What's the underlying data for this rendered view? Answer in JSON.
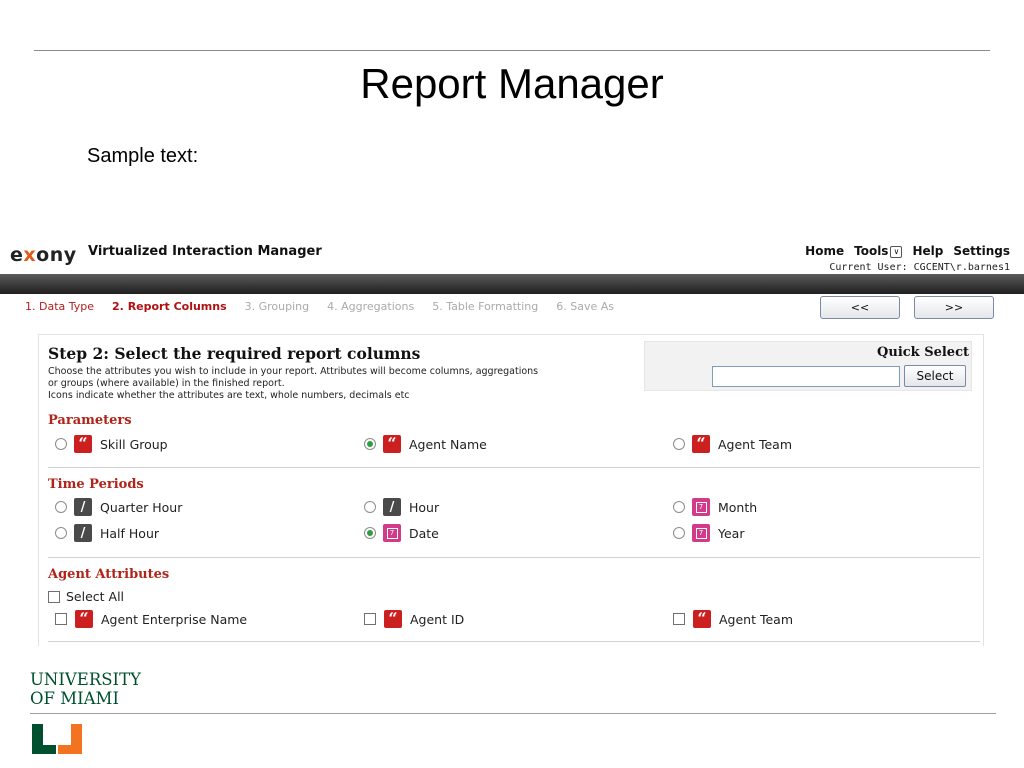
{
  "slide": {
    "title": "Report Manager",
    "sample_text": "Sample text:"
  },
  "app": {
    "logo": {
      "part1": "e",
      "part2": "x",
      "part3": "ony"
    },
    "title": "Virtualized Interaction Manager",
    "nav": {
      "home": "Home",
      "tools": "Tools",
      "help": "Help",
      "settings": "Settings"
    },
    "current_user": "Current User: CGCENT\\r.barnes1"
  },
  "wizard": {
    "steps": [
      {
        "label": "1. Data Type"
      },
      {
        "label": "2. Report Columns"
      },
      {
        "label": "3. Grouping"
      },
      {
        "label": "4. Aggregations"
      },
      {
        "label": "5. Table Formatting"
      },
      {
        "label": "6. Save As"
      }
    ],
    "prev_label": "<<",
    "next_label": ">>"
  },
  "step": {
    "heading": "Step 2: Select the required report columns",
    "desc_line1": "Choose the attributes you wish to include in your report. Attributes will become columns, aggregations",
    "desc_line2": "or groups (where available) in the finished report.",
    "desc_line3": "Icons indicate whether the attributes are text, whole numbers, decimals etc"
  },
  "quick_select": {
    "label": "Quick Select",
    "value": "",
    "button": "Select"
  },
  "parameters": {
    "title": "Parameters",
    "items": [
      {
        "label": "Skill Group",
        "selected": false,
        "icon": "text-icon"
      },
      {
        "label": "Agent Name",
        "selected": true,
        "icon": "text-icon"
      },
      {
        "label": "Agent Team",
        "selected": false,
        "icon": "text-icon"
      }
    ]
  },
  "time_periods": {
    "title": "Time Periods",
    "items": [
      {
        "label": "Quarter Hour",
        "selected": false,
        "icon": "time-icon"
      },
      {
        "label": "Hour",
        "selected": false,
        "icon": "time-icon"
      },
      {
        "label": "Month",
        "selected": false,
        "icon": "calendar-icon"
      },
      {
        "label": "Half Hour",
        "selected": false,
        "icon": "time-icon"
      },
      {
        "label": "Date",
        "selected": true,
        "icon": "calendar-icon"
      },
      {
        "label": "Year",
        "selected": false,
        "icon": "calendar-icon"
      }
    ]
  },
  "agent_attributes": {
    "title": "Agent Attributes",
    "select_all": "Select All",
    "items": [
      {
        "label": "Agent Enterprise Name",
        "checked": false,
        "icon": "text-icon"
      },
      {
        "label": "Agent ID",
        "checked": false,
        "icon": "text-icon"
      },
      {
        "label": "Agent Team",
        "checked": false,
        "icon": "text-icon"
      }
    ]
  },
  "icon_glyphs": {
    "text": "“",
    "time": "/",
    "calendar": "7"
  },
  "footer": {
    "university_line1": "UNIVERSITY",
    "university_line2": "OF MIAMI"
  },
  "colors": {
    "accent_red": "#b0241a",
    "um_green": "#005030",
    "um_orange": "#f47321",
    "radio_green": "#2e9e3e",
    "calendar_pink": "#d23a8a"
  }
}
